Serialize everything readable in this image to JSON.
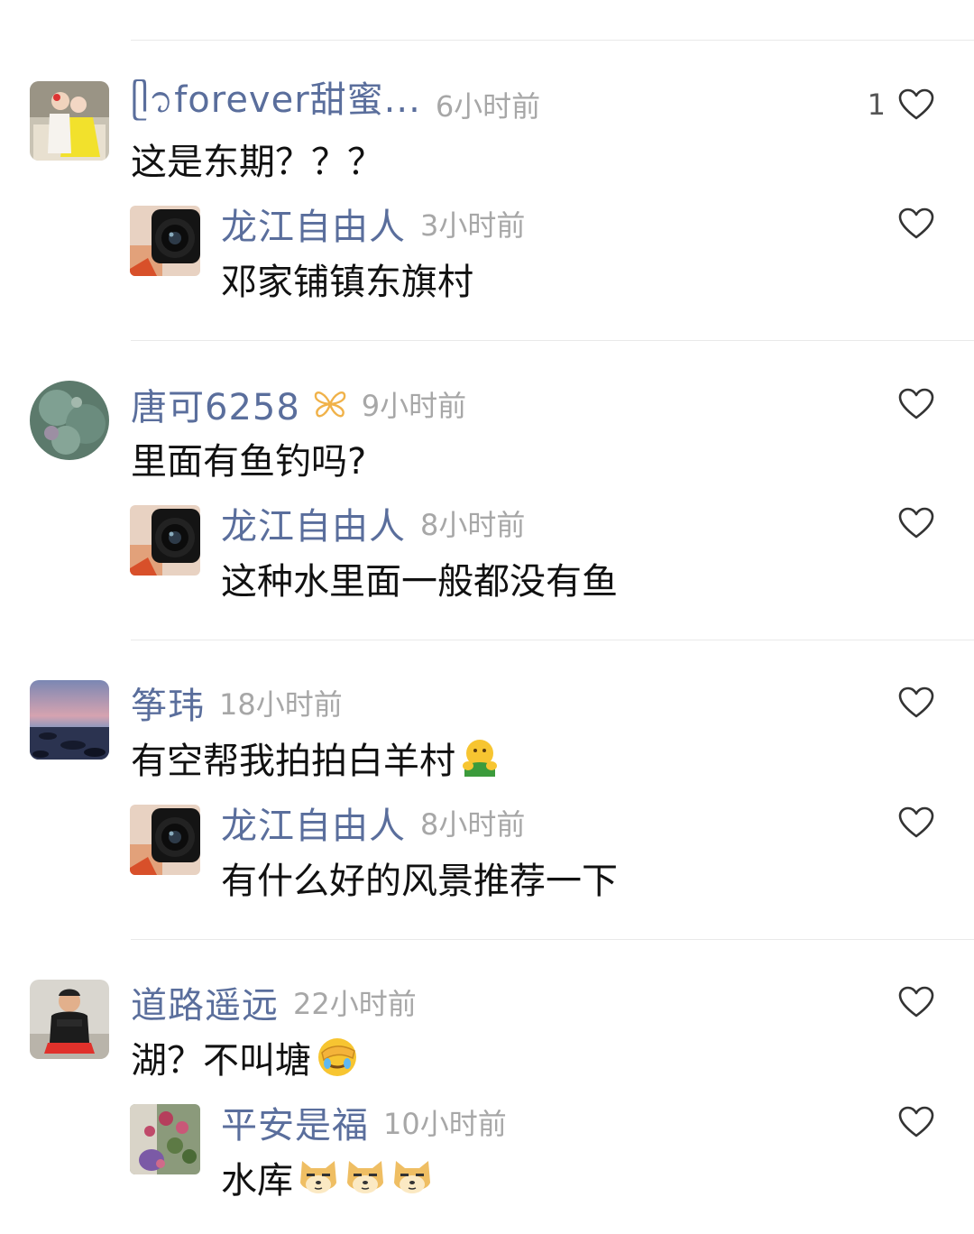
{
  "comments": [
    {
      "user": "ᥫ᭡forever甜蜜...",
      "time": "6小时前",
      "text": "这是东期？？？",
      "likes": "1",
      "reply": {
        "user": "龙江自由人",
        "time": "3小时前",
        "text": "邓家铺镇东旗村"
      }
    },
    {
      "user": "唐可6258",
      "time": "9小时前",
      "text": "里面有鱼钓吗?",
      "likes": "",
      "reply": {
        "user": "龙江自由人",
        "time": "8小时前",
        "text": "这种水里面一般都没有鱼"
      }
    },
    {
      "user": "筝玮",
      "time": "18小时前",
      "text": "有空帮我拍拍白羊村",
      "likes": "",
      "reply": {
        "user": "龙江自由人",
        "time": "8小时前",
        "text": "有什么好的风景推荐一下"
      }
    },
    {
      "user": "道路遥远",
      "time": "22小时前",
      "text": "湖？不叫塘",
      "likes": "",
      "reply": {
        "user": "平安是福",
        "time": "10小时前",
        "text": "水库"
      }
    }
  ],
  "icons": {
    "like": "heart-outline-icon",
    "badge": "butterfly-badge-icon",
    "emoji_hug": "hug-emoji",
    "emoji_facepalm": "facepalm-emoji",
    "emoji_doge": "doge-emoji"
  },
  "colors": {
    "username": "#5a6e9c",
    "time": "#a7a7a7",
    "text": "#111111",
    "divider": "#e9e9e9"
  }
}
